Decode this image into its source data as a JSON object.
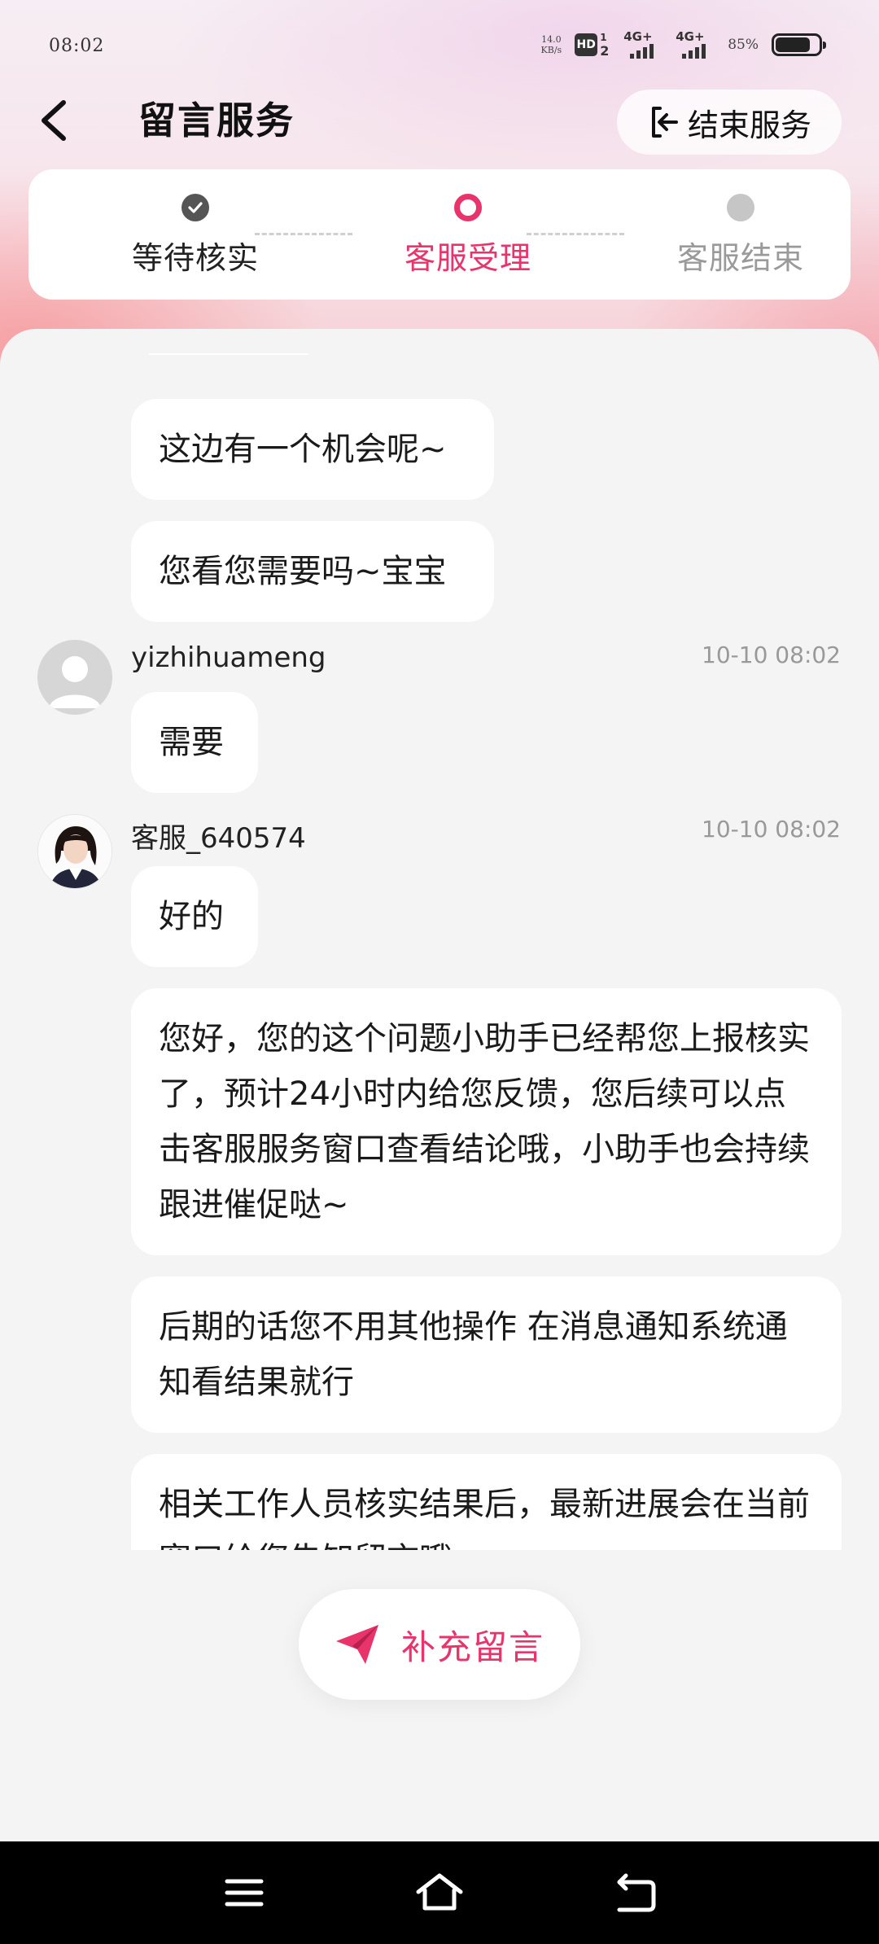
{
  "status_bar": {
    "time": "08:02",
    "net_speed_value": "14.0",
    "net_speed_unit": "KB/s",
    "hd_label": "HD",
    "hd_sup": "1",
    "hd_sub": "2",
    "signal_1": "4G+",
    "signal_2": "4G+",
    "battery": "85%"
  },
  "header": {
    "title": "留言服务",
    "end_button": "结束服务"
  },
  "progress": {
    "steps": [
      {
        "label": "等待核实",
        "state": "done"
      },
      {
        "label": "客服受理",
        "state": "active"
      },
      {
        "label": "客服结束",
        "state": "pending"
      }
    ],
    "active_color": "#e8336b"
  },
  "messages": [
    {
      "text": "这边有一个机会呢~"
    },
    {
      "text": "您看您需要吗~宝宝"
    },
    {
      "sender": "yizhihuameng",
      "time": "10-10 08:02",
      "text": "需要"
    },
    {
      "sender": "客服_640574",
      "time": "10-10 08:02",
      "text": "好的"
    },
    {
      "text": "您好，您的这个问题小助手已经帮您上报核实了，预计24小时内给您反馈，您后续可以点击客服服务窗口查看结论哦，小助手也会持续跟进催促哒~"
    },
    {
      "text": "后期的话您不用其他操作 在消息通知系统通知看结果就行"
    },
    {
      "text": "相关工作人员核实结果后，最新进展会在当前窗口给您告知留言哦"
    }
  ],
  "supplement_button": "补充留言",
  "nav": {
    "icons": [
      "menu-icon",
      "home-icon",
      "back-return-icon"
    ]
  }
}
